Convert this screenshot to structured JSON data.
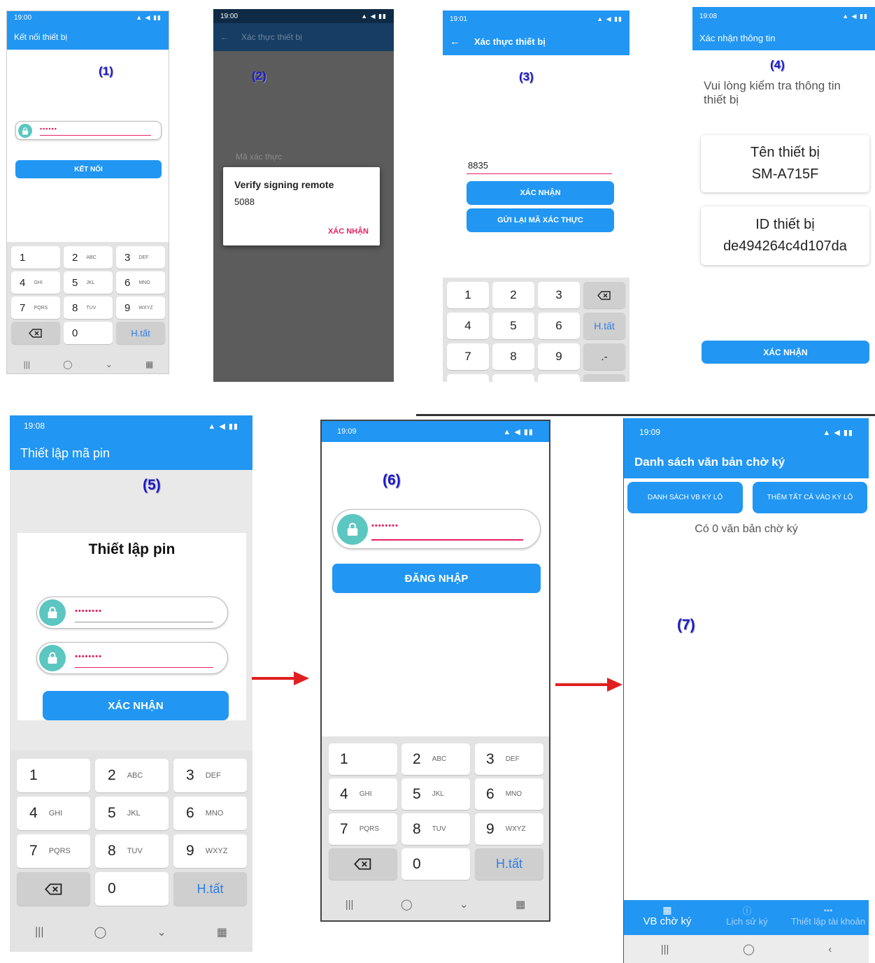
{
  "steps": [
    "(1)",
    "(2)",
    "(3)",
    "(4)",
    "(5)",
    "(6)",
    "(7)"
  ],
  "colors": {
    "primary": "#2196f3",
    "accent": "#e91e63",
    "step_label": "#1a1acc",
    "arrow": "#e02020"
  },
  "s1": {
    "time": "19:00",
    "title": "Kết nối thiết bị",
    "password_mask": "••••••",
    "button": "KẾT NỐI"
  },
  "s2": {
    "time": "19:00",
    "title": "Xác thực thiết bị",
    "field_label": "Mã xác thực",
    "dialog_title": "Verify signing remote",
    "dialog_code": "5088",
    "dialog_button": "XÁC NHẬN"
  },
  "s3": {
    "time": "19:01",
    "title": "Xác thực thiết bị",
    "code_value": "8835",
    "confirm_button": "XÁC NHẬN",
    "resend_button": "GỬI LẠI MÃ XÁC THỰC"
  },
  "s4": {
    "time": "19:08",
    "title": "Xác nhận thông tin",
    "instruction": "Vui lòng kiểm tra thông tin thiết bị",
    "name_label": "Tên thiết bị",
    "name_value": "SM-A715F",
    "id_label": "ID thiết bị",
    "id_value": "de494264c4d107da",
    "button": "XÁC NHẬN"
  },
  "s5": {
    "time": "19:08",
    "title": "Thiết lập mã pin",
    "card_title": "Thiết lập pin",
    "pin_mask": "••••••••",
    "confirm_mask": "••••••••",
    "button": "XÁC NHẬN"
  },
  "s6": {
    "time": "19:09",
    "pin_mask": "••••••••",
    "button": "ĐĂNG NHẬP"
  },
  "s7": {
    "time": "19:09",
    "title": "Danh sách văn bản chờ ký",
    "btn_batch": "DANH SÁCH VB KÝ LÔ",
    "btn_add_all": "THÊM TẤT CẢ VÀO KÝ LÔ",
    "empty_text": "Có 0 văn bản chờ ký",
    "tabs": [
      "VB chờ ký",
      "Lịch sử ký",
      "Thiết lập tài khoản"
    ]
  },
  "keypad_alpha": {
    "keys": [
      {
        "n": "1",
        "l": ""
      },
      {
        "n": "2",
        "l": "ABC"
      },
      {
        "n": "3",
        "l": "DEF"
      },
      {
        "n": "4",
        "l": "GHI"
      },
      {
        "n": "5",
        "l": "JKL"
      },
      {
        "n": "6",
        "l": "MNO"
      },
      {
        "n": "7",
        "l": "PQRS"
      },
      {
        "n": "8",
        "l": "TUV"
      },
      {
        "n": "9",
        "l": "WXYZ"
      }
    ],
    "zero": "0",
    "done": "H.tất"
  },
  "keypad_numeric": {
    "rows": [
      [
        "1",
        "2",
        "3"
      ],
      [
        "4",
        "5",
        "6"
      ],
      [
        "7",
        "8",
        "9"
      ]
    ],
    "done": "H.tất",
    "dotdash": ".-"
  }
}
